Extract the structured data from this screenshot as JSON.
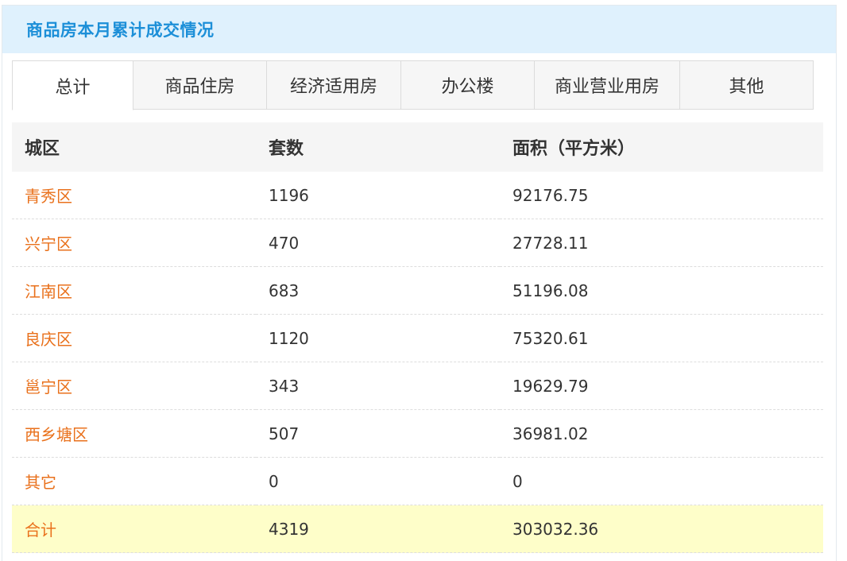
{
  "panel": {
    "title": "商品房本月累计成交情况"
  },
  "tabs": [
    {
      "label": "总计",
      "active": true
    },
    {
      "label": "商品住房",
      "active": false
    },
    {
      "label": "经济适用房",
      "active": false
    },
    {
      "label": "办公楼",
      "active": false
    },
    {
      "label": "商业营业用房",
      "active": false
    },
    {
      "label": "其他",
      "active": false
    }
  ],
  "table": {
    "headers": [
      "城区",
      "套数",
      "面积（平方米）"
    ],
    "rows": [
      {
        "district": "青秀区",
        "units": "1196",
        "area": "92176.75"
      },
      {
        "district": "兴宁区",
        "units": "470",
        "area": "27728.11"
      },
      {
        "district": "江南区",
        "units": "683",
        "area": "51196.08"
      },
      {
        "district": "良庆区",
        "units": "1120",
        "area": "75320.61"
      },
      {
        "district": "邕宁区",
        "units": "343",
        "area": "19629.79"
      },
      {
        "district": "西乡塘区",
        "units": "507",
        "area": "36981.02"
      },
      {
        "district": "其它",
        "units": "0",
        "area": "0"
      }
    ],
    "total": {
      "label": "合计",
      "units": "4319",
      "area": "303032.36"
    }
  },
  "colors": {
    "title": "#1c8fd8",
    "header_bg": "#dff1fd",
    "district_link": "#e9711c",
    "total_row_bg": "#fefec9"
  }
}
